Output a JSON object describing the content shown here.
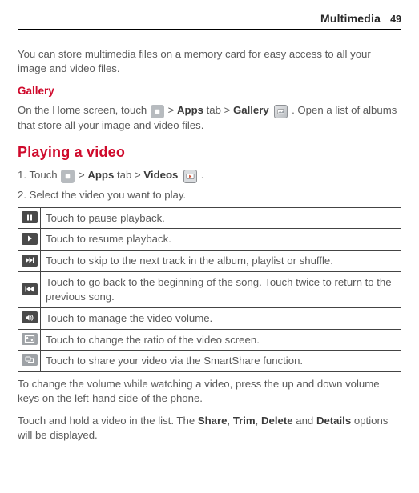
{
  "header": {
    "title": "Multimedia",
    "page": "49"
  },
  "intro": "You can store multimedia files on a memory card for easy access to all your image and video files.",
  "gallery": {
    "heading": "Gallery",
    "line_a": "On the Home screen, touch ",
    "gt1": " > ",
    "apps": "Apps",
    "tab_gt": " tab > ",
    "gallery_word": "Gallery",
    "line_b": ". Open a list of albums that store all your image and video files."
  },
  "playing": {
    "heading": "Playing a video",
    "step1_a": "Touch ",
    "step1_gt": " > ",
    "step1_apps": "Apps",
    "step1_tabgt": " tab > ",
    "step1_videos": "Videos",
    "step1_end": ".",
    "step2": "Select the video you want to play."
  },
  "controls": [
    {
      "desc": "Touch to pause playback."
    },
    {
      "desc": "Touch to resume playback."
    },
    {
      "desc": "Touch to skip to the next track in the album, playlist or shuffle."
    },
    {
      "desc": "Touch to go back to the beginning of the song. Touch twice to return to the previous song."
    },
    {
      "desc": "Touch to manage the video volume."
    },
    {
      "desc": "Touch to change the ratio of the video screen."
    },
    {
      "desc": "Touch to share your video via the SmartShare function."
    }
  ],
  "after1": "To change the volume while watching a video, press the up and down volume keys on the left-hand side of the phone.",
  "after2_a": "Touch and hold a video in the list. The ",
  "after2_share": "Share",
  "after2_c1": ", ",
  "after2_trim": "Trim",
  "after2_c2": ", ",
  "after2_delete": "Delete",
  "after2_and": " and ",
  "after2_details": "Details",
  "after2_end": " options will be displayed."
}
